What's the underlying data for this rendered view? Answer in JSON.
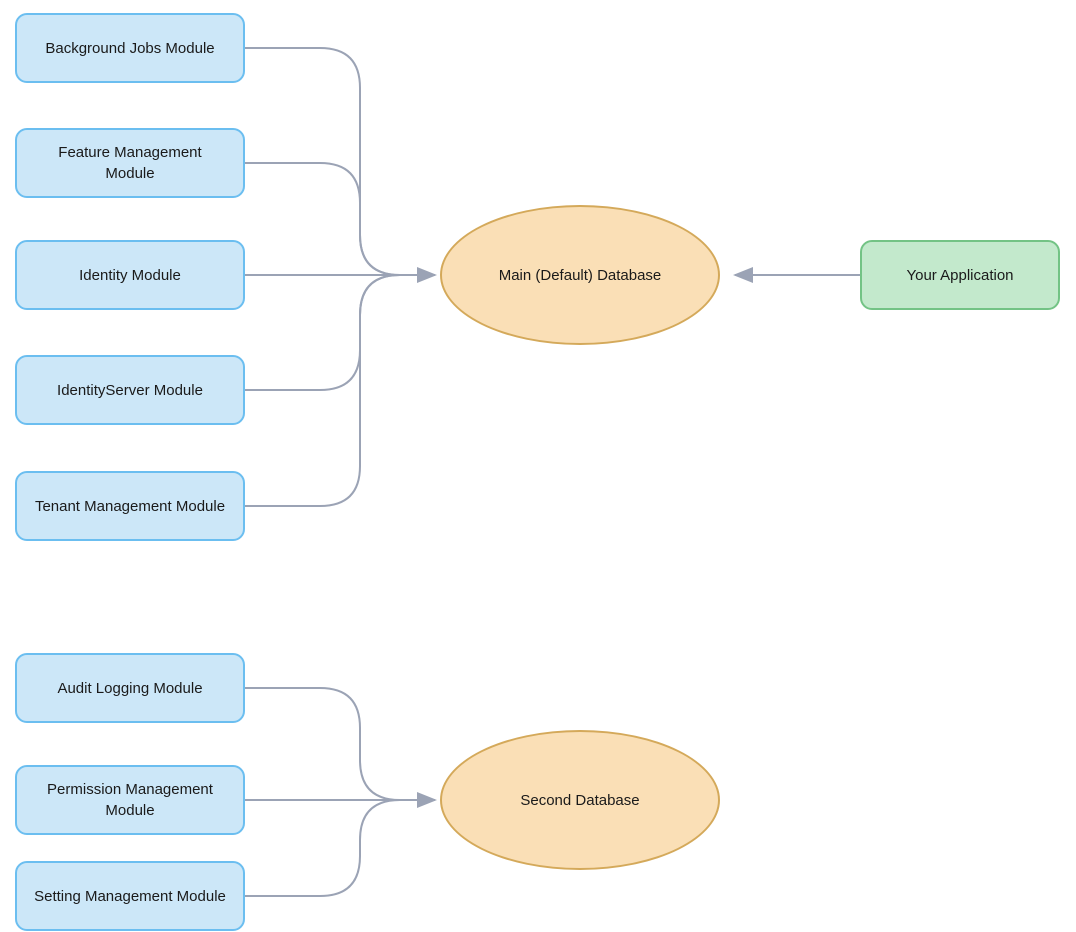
{
  "modules_top": [
    {
      "label": "Background Jobs Module"
    },
    {
      "label": "Feature Management Module"
    },
    {
      "label": "Identity Module"
    },
    {
      "label": "IdentityServer Module"
    },
    {
      "label": "Tenant Management Module"
    }
  ],
  "modules_bottom": [
    {
      "label": "Audit Logging Module"
    },
    {
      "label": "Permission Management Module"
    },
    {
      "label": "Setting Management Module"
    }
  ],
  "databases": {
    "main": "Main (Default) Database",
    "second": "Second Database"
  },
  "app": {
    "label": "Your Application"
  },
  "colors": {
    "module_fill": "#cce7f8",
    "module_border": "#6bbef0",
    "db_fill": "#fadfb6",
    "db_border": "#d4a95a",
    "app_fill": "#c3e9cc",
    "app_border": "#73c385",
    "connector": "#9ba3b5"
  }
}
